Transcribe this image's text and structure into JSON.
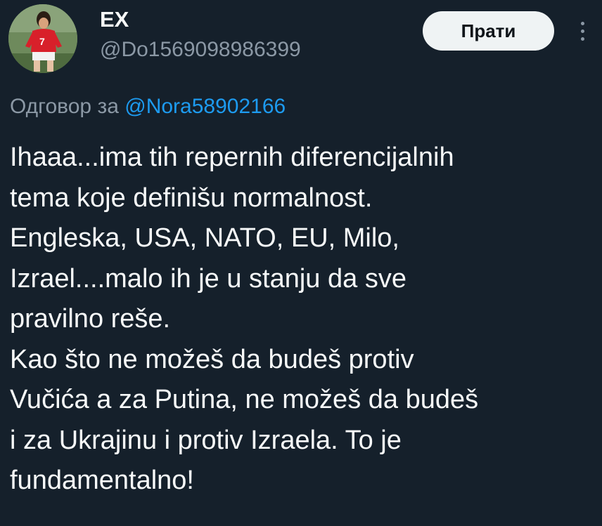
{
  "author": {
    "display_name": "EX",
    "handle": "@Do1569098986399",
    "avatar_icon": "avatar-footballer-photo"
  },
  "actions": {
    "follow_label": "Прати",
    "more_icon": "more-vertical-icon"
  },
  "reply": {
    "prefix": "Одговор за",
    "mention": "@Nora58902166"
  },
  "tweet": {
    "lines": [
      "Ihaaa...ima tih repernih diferencijalnih",
      "tema koje definišu normalnost.",
      "Engleska, USA, NATO, EU, Milo,",
      "Izrael....malo ih je u stanju da sve",
      "pravilno reše.",
      "Kao što ne možeš da budeš protiv",
      "Vučića a za Putina, ne možeš da budeš",
      "i za Ukrajinu i protiv Izraela. To je",
      "fundamentalno!"
    ]
  },
  "colors": {
    "background": "#15202b",
    "text_primary": "#f7f9f9",
    "text_secondary": "#8b98a5",
    "link": "#1d9bf0",
    "follow_button_bg": "#eff3f4"
  }
}
